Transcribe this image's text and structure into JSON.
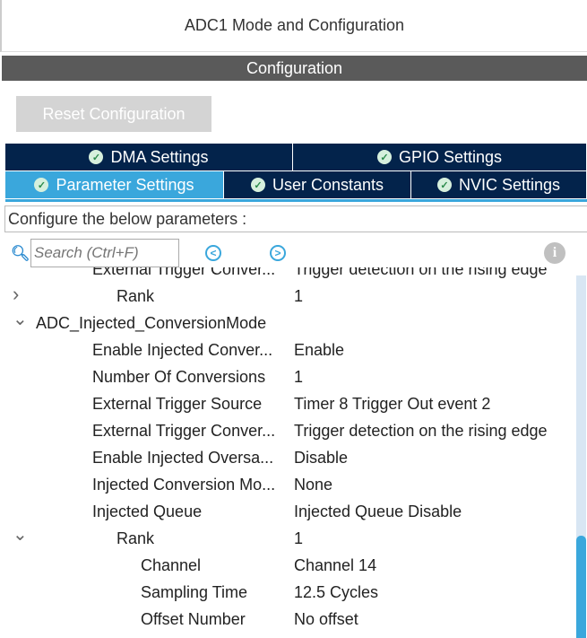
{
  "title": "ADC1 Mode and Configuration",
  "section": "Configuration",
  "reset_label": "Reset Configuration",
  "tabs": [
    {
      "label": "DMA Settings",
      "active": false
    },
    {
      "label": "GPIO Settings",
      "active": false
    },
    {
      "label": "Parameter Settings",
      "active": true
    },
    {
      "label": "User Constants",
      "active": false
    },
    {
      "label": "NVIC Settings",
      "active": false
    }
  ],
  "hint": "Configure the below parameters :",
  "search_placeholder": "Search (Ctrl+F)",
  "rows": [
    {
      "label": "External Trigger Conver...",
      "value": "Trigger detection on the rising edge",
      "level": 2
    },
    {
      "label": "Rank",
      "value": "1",
      "level": 3,
      "arrow": ">"
    },
    {
      "label": "ADC_Injected_ConversionMode",
      "value": "",
      "level": 0,
      "arrow": "v"
    },
    {
      "label": "Enable Injected Conver...",
      "value": "Enable",
      "level": 2
    },
    {
      "label": "Number Of Conversions",
      "value": "1",
      "level": 2
    },
    {
      "label": "External Trigger Source",
      "value": "Timer 8 Trigger Out event 2",
      "level": 2
    },
    {
      "label": "External Trigger Conver...",
      "value": "Trigger detection on the rising edge",
      "level": 2
    },
    {
      "label": "Enable Injected Oversa...",
      "value": "Disable",
      "level": 2
    },
    {
      "label": "Injected Conversion Mo...",
      "value": "None",
      "level": 2
    },
    {
      "label": "Injected Queue",
      "value": "Injected Queue Disable",
      "level": 2
    },
    {
      "label": "Rank",
      "value": "1",
      "level": 3,
      "arrow": "v"
    },
    {
      "label": "Channel",
      "value": "Channel 14",
      "level": 4
    },
    {
      "label": "Sampling Time",
      "value": "12.5 Cycles",
      "level": 4
    },
    {
      "label": "Offset Number",
      "value": "No offset",
      "level": 4
    }
  ],
  "colors": {
    "tab_dark": "#03234b",
    "tab_active": "#3aa7dc",
    "header_bar": "#5a5a5a"
  }
}
